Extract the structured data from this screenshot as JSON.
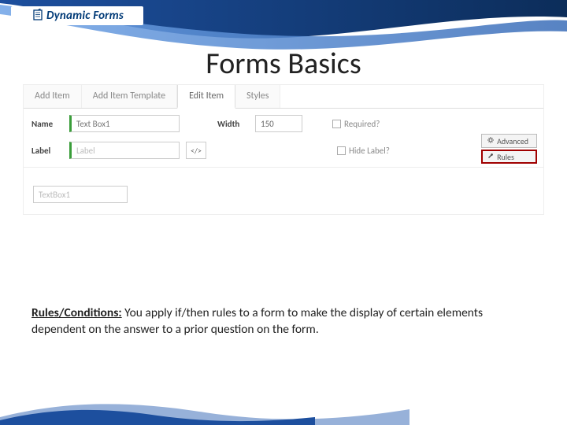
{
  "logo": {
    "text": "Dynamic Forms"
  },
  "title": "Forms Basics",
  "tabs": [
    "Add Item",
    "Add Item Template",
    "Edit Item",
    "Styles"
  ],
  "active_tab_index": 2,
  "fields": {
    "name_label": "Name",
    "name_value": "Text Box1",
    "label_label": "Label",
    "label_placeholder": "Label",
    "code_btn": "</>",
    "width_label": "Width",
    "width_value": "150",
    "required_label": "Required?",
    "hidelabel_label": "Hide Label?"
  },
  "side_buttons": {
    "advanced": "Advanced",
    "rules": "Rules"
  },
  "preview_placeholder": "TextBox1",
  "caption": {
    "bold": "Rules/Conditions:",
    "rest": "  You apply if/then rules to a form to make the display of certain elements dependent on the answer to a prior question on the form."
  }
}
